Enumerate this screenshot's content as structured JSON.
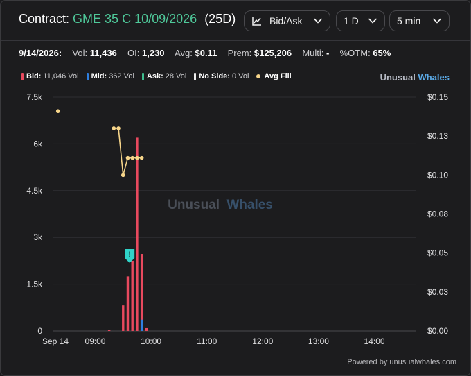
{
  "header": {
    "contract_label": "Contract:",
    "contract": "GME 35 C 10/09/2026",
    "dte": "(25D)",
    "mode_button": "Bid/Ask",
    "range_button": "1 D",
    "interval_button": "5 min"
  },
  "stats": {
    "date": "9/14/2026:",
    "vol_label": "Vol:",
    "vol": "11,436",
    "oi_label": "OI:",
    "oi": "1,230",
    "avg_label": "Avg:",
    "avg": "$0.11",
    "prem_label": "Prem:",
    "prem": "$125,206",
    "multi_label": "Multi:",
    "multi": "-",
    "otm_label": "%OTM:",
    "otm": "65%"
  },
  "legend": [
    {
      "name": "Bid:",
      "value": "11,046 Vol",
      "color": "#e8495e",
      "kind": "bar"
    },
    {
      "name": "Mid:",
      "value": "362 Vol",
      "color": "#2e7fe0",
      "kind": "bar"
    },
    {
      "name": "Ask:",
      "value": "28 Vol",
      "color": "#3fbf8f",
      "kind": "bar"
    },
    {
      "name": "No Side:",
      "value": "0 Vol",
      "color": "#ececec",
      "kind": "bar"
    },
    {
      "name": "Avg Fill",
      "value": "",
      "color": "#f6d58a",
      "kind": "dot"
    }
  ],
  "brand": {
    "word1": "Unusual",
    "word2": "Whales"
  },
  "watermark": {
    "word1": "Unusual",
    "word2": "Whales"
  },
  "annotation_marker": "!",
  "footer": "Powered by unusualwhales.com",
  "colors": {
    "bid": "#e8495e",
    "mid": "#2e7fe0",
    "ask": "#3fbf8f",
    "avg_fill": "#f6d58a",
    "marker": "#2fd3c8"
  },
  "chart_data": {
    "type": "bar",
    "x_tick_labels": [
      "Sep 14",
      "09:00",
      "10:00",
      "11:00",
      "12:00",
      "13:00",
      "14:00"
    ],
    "x_ticks_minutes": [
      0,
      540,
      600,
      660,
      720,
      780,
      840
    ],
    "x_range_minutes": [
      495,
      885
    ],
    "y_left_ticks": [
      "0",
      "1.5k",
      "3k",
      "4.5k",
      "6k",
      "7.5k"
    ],
    "y_left_ylim": [
      0,
      7500
    ],
    "y_right_ticks": [
      "$0.00",
      "$0.03",
      "$0.05",
      "$0.08",
      "$0.10",
      "$0.13",
      "$0.15"
    ],
    "y_right_ylim": [
      0,
      0.15
    ],
    "grid": true,
    "legend_position": "top",
    "series": [
      {
        "name": "Bid",
        "minutes": [
          555,
          570,
          575,
          580,
          585,
          590,
          595
        ],
        "values": [
          40,
          820,
          1750,
          2250,
          6200,
          2470,
          90
        ]
      },
      {
        "name": "Mid",
        "minutes": [
          590
        ],
        "values": [
          362
        ]
      },
      {
        "name": "Avg Fill",
        "minutes": [
          500,
          560,
          565,
          570,
          575,
          580,
          585,
          590
        ],
        "values": [
          0.141,
          0.13,
          0.13,
          0.1,
          0.111,
          0.111,
          0.111,
          0.111
        ]
      }
    ],
    "annotations": [
      {
        "minute": 577,
        "value": 2180,
        "label": "!"
      }
    ]
  }
}
